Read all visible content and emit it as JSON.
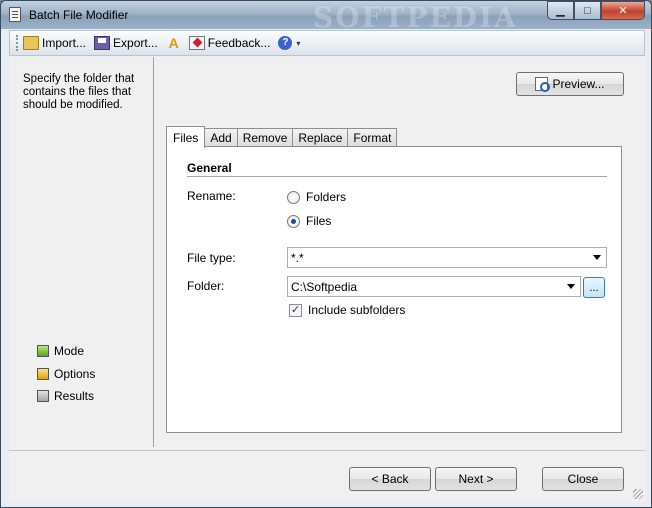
{
  "window": {
    "title": "Batch File Modifier",
    "watermark": "SOFTPEDIA",
    "controls": {
      "minimize": "▁",
      "maximize": "□",
      "close": "✕"
    }
  },
  "toolbar": {
    "import_label": "Import...",
    "export_label": "Export...",
    "feedback_label": "Feedback...",
    "help_glyph": "?",
    "help_caret": "▾"
  },
  "sidebar": {
    "description": "Specify the folder that contains the files that should be modified.",
    "steps": [
      {
        "label": "Mode",
        "status": "green"
      },
      {
        "label": "Options",
        "status": "yellow"
      },
      {
        "label": "Results",
        "status": "grey"
      }
    ]
  },
  "preview_button": "Preview...",
  "tabs": [
    "Files",
    "Add",
    "Remove",
    "Replace",
    "Format"
  ],
  "active_tab": "Files",
  "files_panel": {
    "group_title": "General",
    "rename_label": "Rename:",
    "rename_options": [
      "Folders",
      "Files"
    ],
    "rename_selected": "Files",
    "file_type_label": "File type:",
    "file_type_value": "*.*",
    "folder_label": "Folder:",
    "folder_value": "C:\\Softpedia",
    "browse_label": "...",
    "include_subfolders_label": "Include subfolders",
    "include_subfolders_checked": true
  },
  "nav": {
    "back_label": "< Back",
    "next_label": "Next >",
    "close_label": "Close"
  }
}
